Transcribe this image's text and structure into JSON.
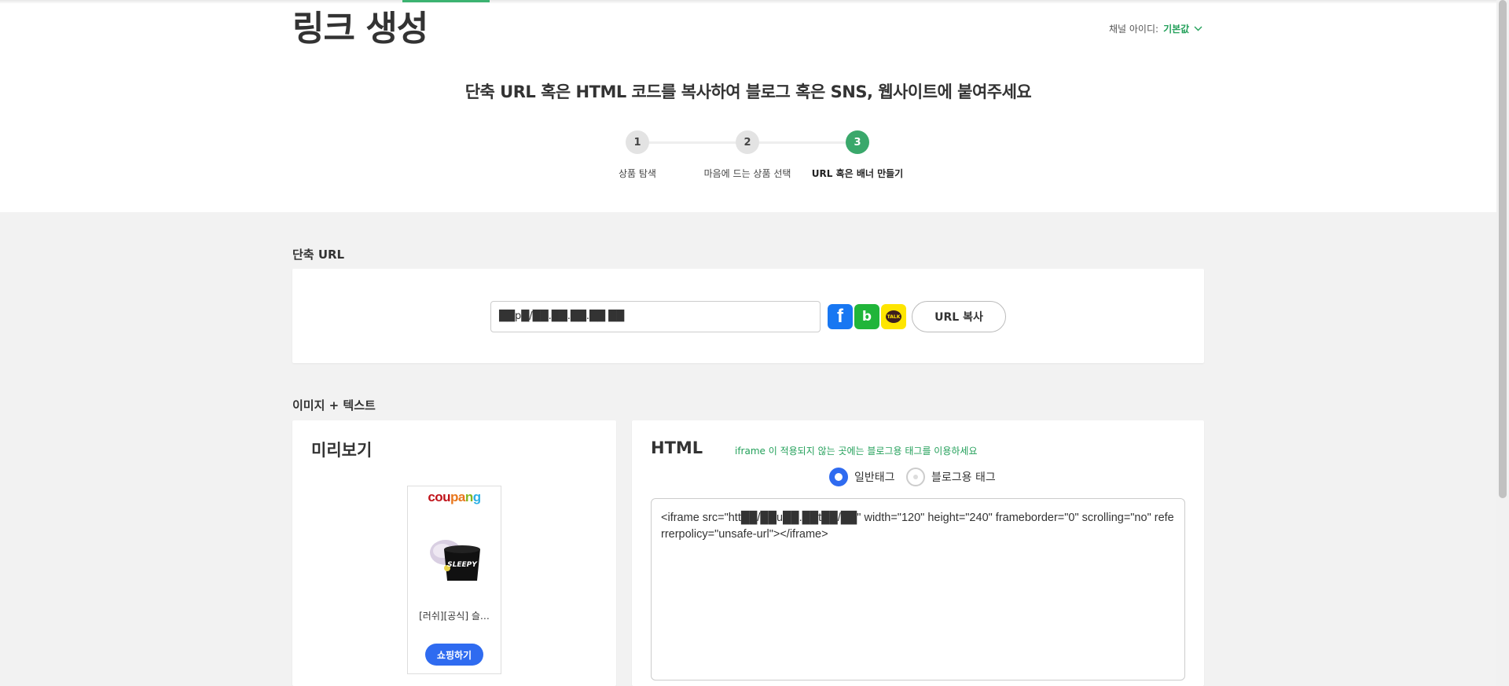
{
  "header": {
    "title": "링크 생성",
    "channel_label": "채널 아이디:",
    "channel_value": "기본값",
    "headline": "단축 URL 혹은 HTML 코드를 복사하여 블로그 혹은 SNS, 웹사이트에 붙여주세요"
  },
  "steps": [
    {
      "num": "1",
      "label": "상품 탐색"
    },
    {
      "num": "2",
      "label": "마음에 드는 상품 선택"
    },
    {
      "num": "3",
      "label": "URL 혹은 배너 만들기"
    }
  ],
  "short_url": {
    "section_title": "단축 URL",
    "value": "██p█/██.██.██.██ ██",
    "copy_button": "URL 복사",
    "share": {
      "facebook": "f",
      "band": "b",
      "kakao": "TALK"
    }
  },
  "image_text": {
    "section_title": "이미지 + 텍스트",
    "preview_title": "미리보기",
    "html_title": "HTML",
    "html_hint": "iframe 이 적용되지 않는 곳에는 블로그용 태그를 이용하세요",
    "radio_normal": "일반태그",
    "radio_blog": "블로그용 태그",
    "code": "<iframe src=\"htt██/██u██.██t██/██\" width=\"120\" height=\"240\" frameborder=\"0\" scrolling=\"no\" referrerpolicy=\"unsafe-url\"></iframe>",
    "preview": {
      "logo_parts": [
        "cou",
        "pa",
        "n",
        "g"
      ],
      "product_name": "[러쉬][공식] 슬…",
      "product_label": "SLEEPY",
      "shop_button": "쇼핑하기"
    }
  },
  "colors": {
    "accent_green": "#3aa86b",
    "primary_blue": "#2f6bf0"
  }
}
